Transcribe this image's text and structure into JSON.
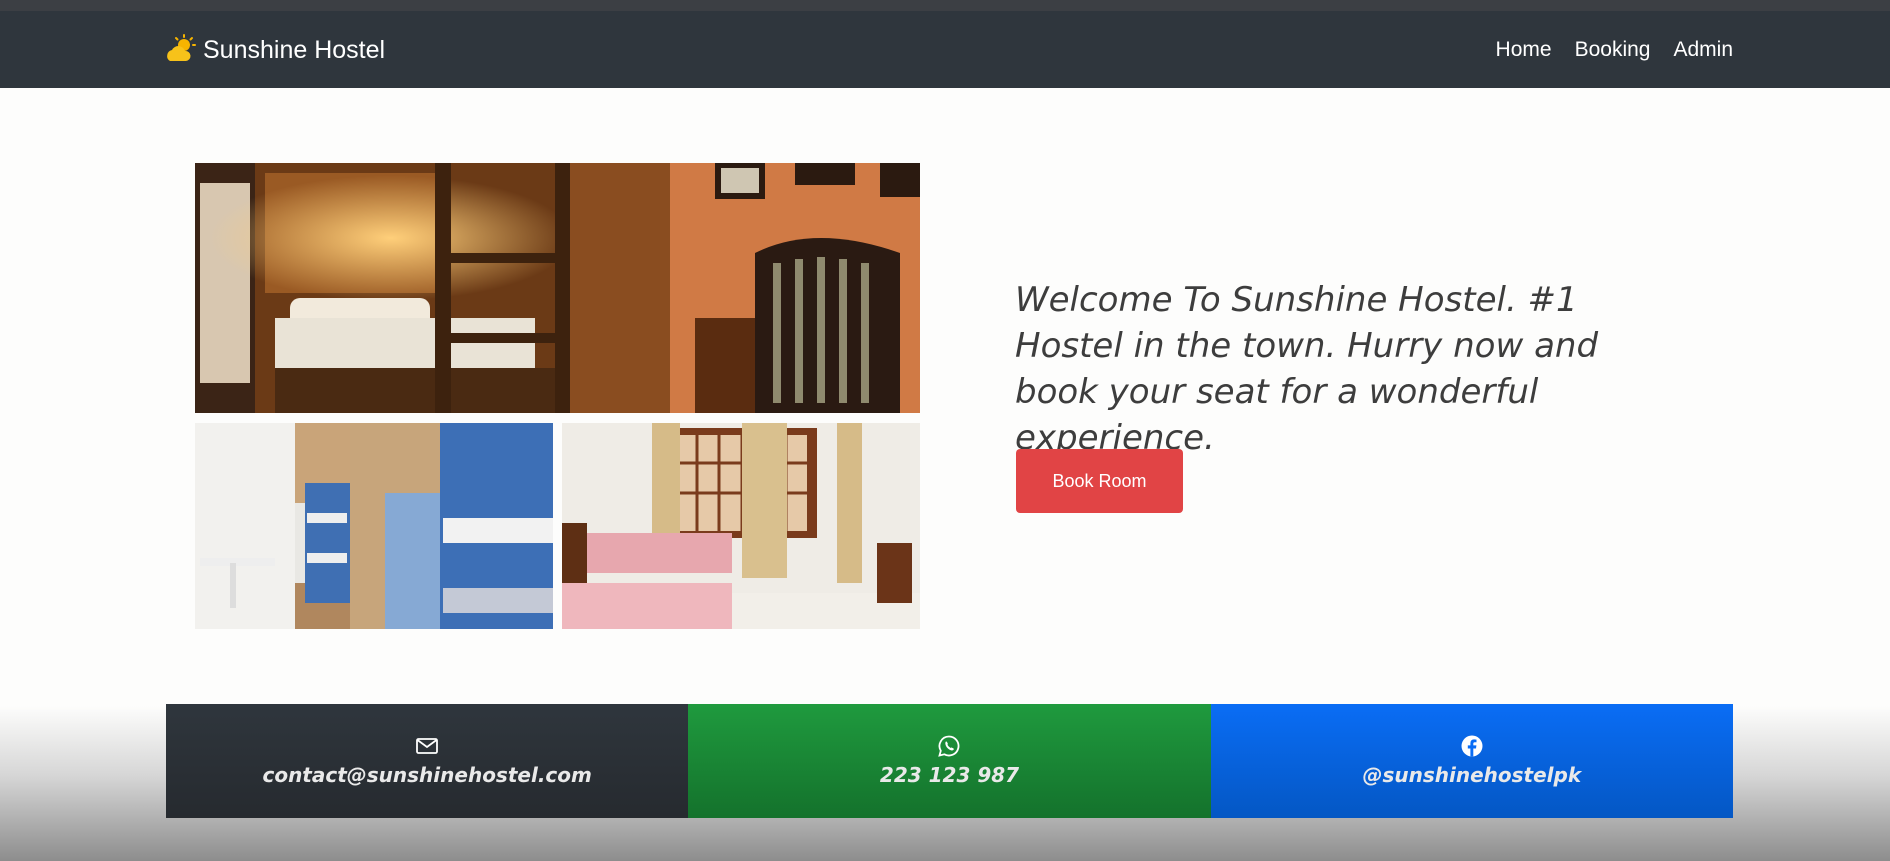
{
  "navbar": {
    "brand": "Sunshine Hostel",
    "brand_icon": "sun-behind-cloud-icon",
    "links": [
      "Home",
      "Booking",
      "Admin"
    ]
  },
  "hero": {
    "headline": "Welcome To Sunshine Hostel. #1 Hostel in the town. Hurry now and book your seat for a wonderful experience.",
    "button_label": "Book Room"
  },
  "contact": {
    "email": {
      "icon": "envelope-icon",
      "text": "contact@sunshinehostel.com"
    },
    "whatsapp": {
      "icon": "whatsapp-icon",
      "text": "223 123 987"
    },
    "facebook": {
      "icon": "facebook-icon",
      "text": "@sunshinehostelpk"
    }
  },
  "colors": {
    "navbar": "#2f363d",
    "accent_button": "#e14445",
    "email_bg": "#2f363d",
    "whatsapp_bg": "#1f9a3e",
    "facebook_bg": "#0a6df5"
  }
}
